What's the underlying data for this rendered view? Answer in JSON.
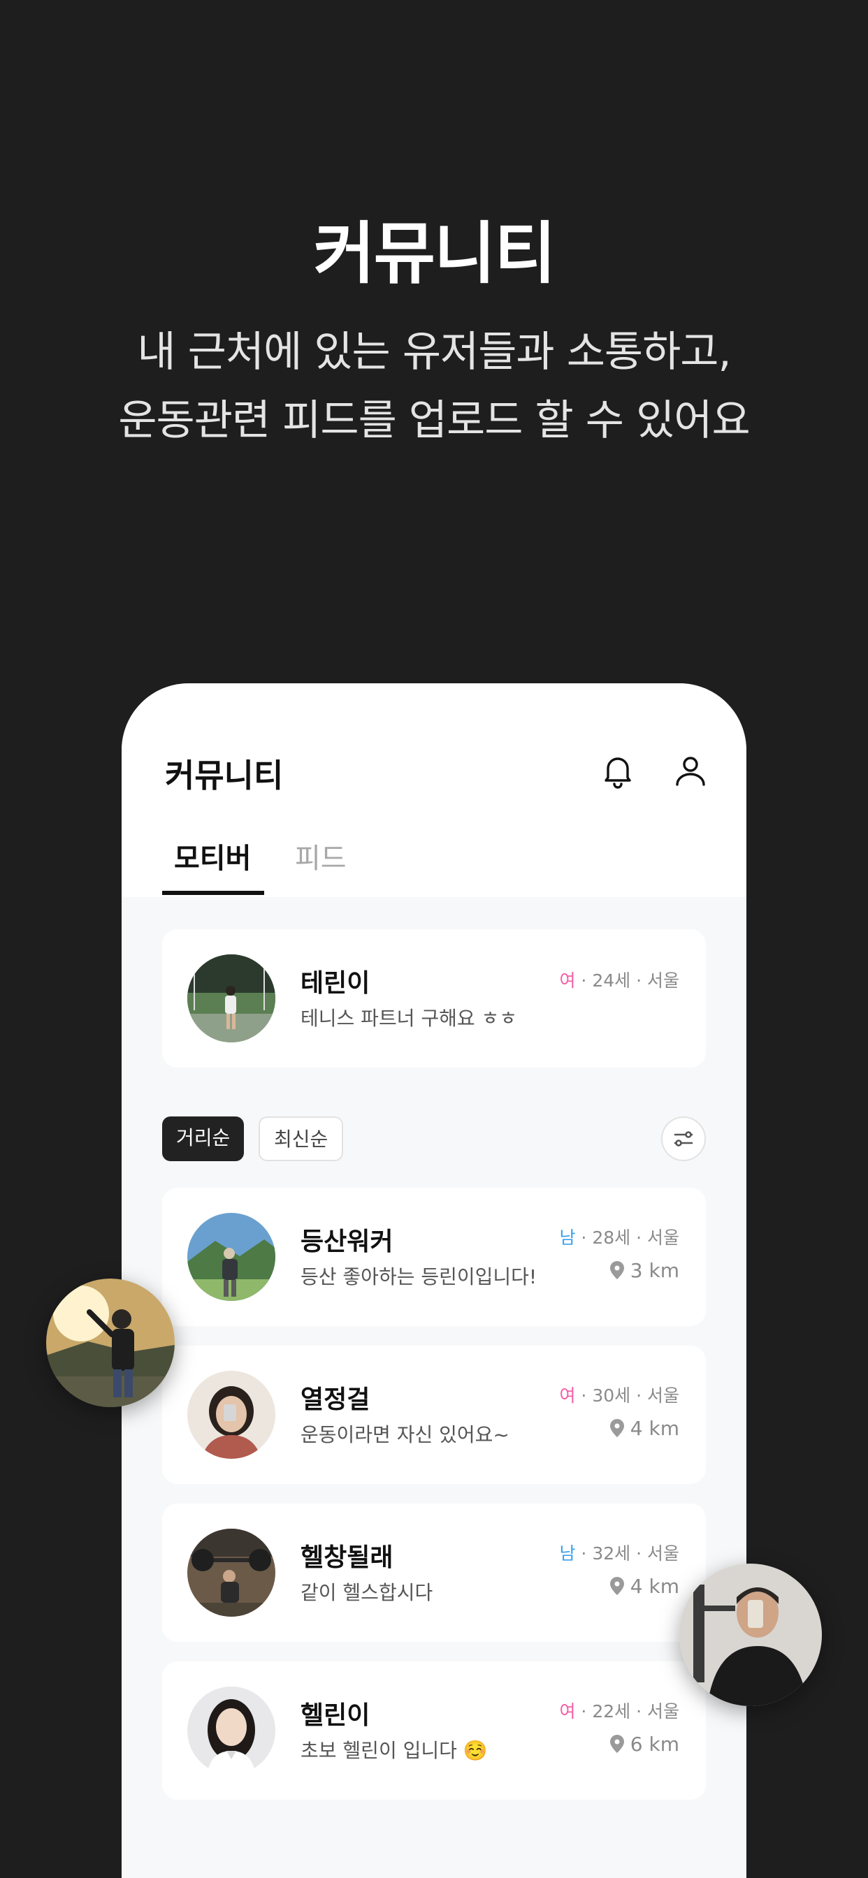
{
  "hero": {
    "title": "커뮤니티",
    "subtitle_line1": "내 근처에 있는 유저들과 소통하고,",
    "subtitle_line2": "운동관련 피드를 업로드 할 수 있어요"
  },
  "app": {
    "title": "커뮤니티",
    "icons": [
      "bell-icon",
      "profile-icon"
    ],
    "tabs": [
      {
        "label": "모티버",
        "active": true
      },
      {
        "label": "피드",
        "active": false
      }
    ]
  },
  "my_card": {
    "nickname": "테린이",
    "intro": "테니스 파트너 구해요 ㅎㅎ",
    "gender": "여",
    "age": "24세",
    "region": "서울"
  },
  "sort": {
    "options": [
      {
        "label": "거리순",
        "active": true
      },
      {
        "label": "최신순",
        "active": false
      }
    ],
    "filter_icon": "filter-icon"
  },
  "users": [
    {
      "nickname": "등산워커",
      "intro": "등산 좋아하는 등린이입니다!",
      "gender": "남",
      "age": "28세",
      "region": "서울",
      "distance": "3 km"
    },
    {
      "nickname": "열정걸",
      "intro": "운동이라면 자신 있어요~",
      "gender": "여",
      "age": "30세",
      "region": "서울",
      "distance": "4 km"
    },
    {
      "nickname": "헬창될래",
      "intro": "같이 헬스합시다",
      "gender": "남",
      "age": "32세",
      "region": "서울",
      "distance": "4 km"
    },
    {
      "nickname": "헬린이",
      "intro": "초보 헬린이 입니다 ☺️",
      "gender": "여",
      "age": "22세",
      "region": "서울",
      "distance": "6 km"
    }
  ],
  "colors": {
    "background": "#1e1e1f",
    "female": "#f25fa7",
    "male": "#3aa0ec",
    "chip_active": "#222222"
  }
}
